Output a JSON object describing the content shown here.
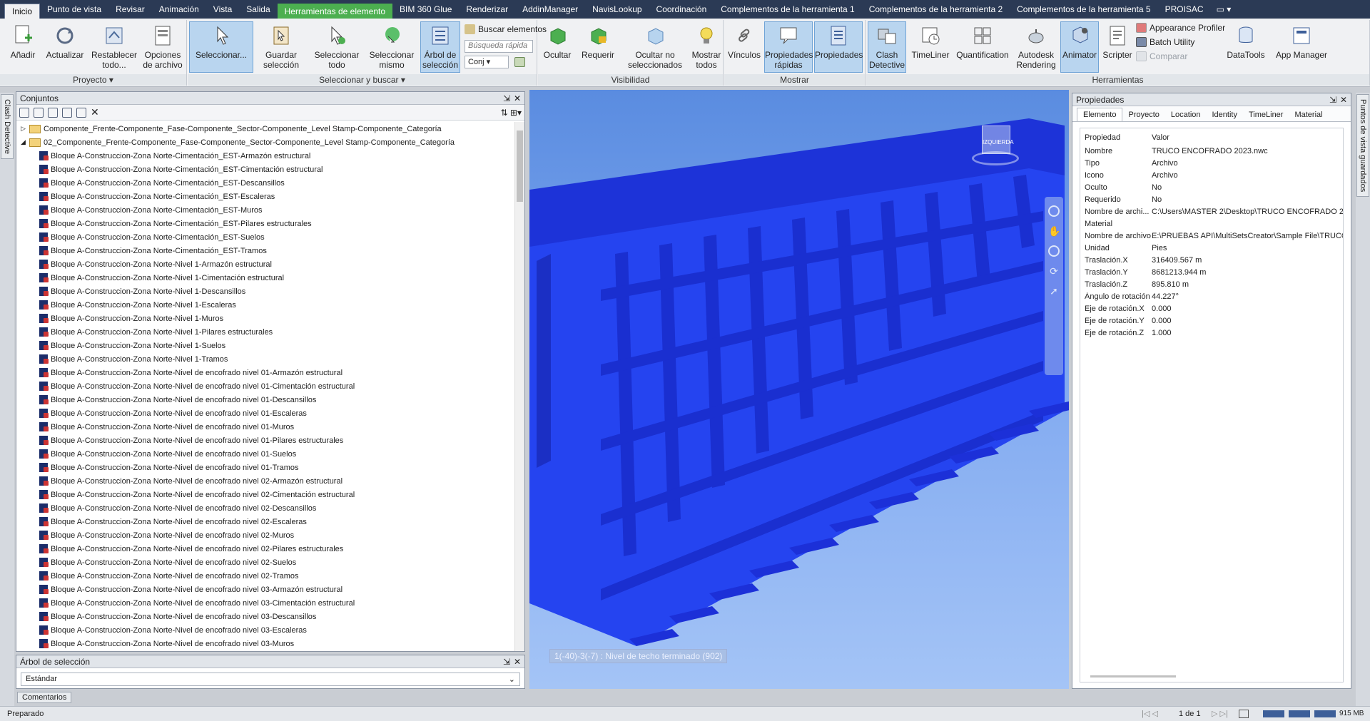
{
  "tabs": [
    "Inicio",
    "Punto de vista",
    "Revisar",
    "Animación",
    "Vista",
    "Salida",
    "Herramientas de elemento",
    "BIM 360 Glue",
    "Renderizar",
    "AddinManager",
    "NavisLookup",
    "Coordinación",
    "Complementos de la herramienta 1",
    "Complementos de la herramienta 2",
    "Complementos de la herramienta 5",
    "PROISAC"
  ],
  "active_tab_index": 6,
  "ribbon": {
    "proyecto": {
      "title": "Proyecto",
      "anadir": "Añadir",
      "actualizar": "Actualizar",
      "restablecer": "Restablecer todo...",
      "opciones": "Opciones de archivo"
    },
    "seleccionar": {
      "title": "Seleccionar y buscar",
      "seleccionar": "Seleccionar...",
      "guardar": "Guardar selección",
      "sel_todo": "Seleccionar todo",
      "sel_mismo": "Seleccionar mismo",
      "arbol": "Árbol de selección",
      "buscar": "Buscar elementos",
      "busqueda_placeholder": "Búsqueda rápida",
      "conj": "Conj"
    },
    "visibilidad": {
      "title": "Visibilidad",
      "ocultar": "Ocultar",
      "requerir": "Requerir",
      "ocultar_no": "Ocultar no seleccionados",
      "mostrar": "Mostrar todos"
    },
    "mostrar": {
      "title": "Mostrar",
      "vinculos": "Vínculos",
      "prop_rapidas": "Propiedades rápidas",
      "propiedades": "Propiedades"
    },
    "herramientas": {
      "title": "Herramientas",
      "clash": "Clash Detective",
      "timeliner": "TimeLiner",
      "quantification": "Quantification",
      "autodesk": "Autodesk Rendering",
      "animator": "Animator",
      "scripter": "Scripter",
      "appearance": "Appearance Profiler",
      "batch": "Batch Utility",
      "comparar": "Comparar",
      "datatools": "DataTools",
      "appmanager": "App Manager"
    }
  },
  "left_vtab": "Clash Detective",
  "right_vtab": "Puntos de vista guardados",
  "conjuntos": {
    "title": "Conjuntos",
    "root1": "Componente_Frente-Componente_Fase-Componente_Sector-Componente_Level Stamp-Componente_Categoría",
    "root2": "02_Componente_Frente-Componente_Fase-Componente_Sector-Componente_Level Stamp-Componente_Categoría",
    "items": [
      "Bloque A-Construccion-Zona Norte-Cimentación_EST-Armazón estructural",
      "Bloque A-Construccion-Zona Norte-Cimentación_EST-Cimentación estructural",
      "Bloque A-Construccion-Zona Norte-Cimentación_EST-Descansillos",
      "Bloque A-Construccion-Zona Norte-Cimentación_EST-Escaleras",
      "Bloque A-Construccion-Zona Norte-Cimentación_EST-Muros",
      "Bloque A-Construccion-Zona Norte-Cimentación_EST-Pilares estructurales",
      "Bloque A-Construccion-Zona Norte-Cimentación_EST-Suelos",
      "Bloque A-Construccion-Zona Norte-Cimentación_EST-Tramos",
      "Bloque A-Construccion-Zona Norte-Nivel 1-Armazón estructural",
      "Bloque A-Construccion-Zona Norte-Nivel 1-Cimentación estructural",
      "Bloque A-Construccion-Zona Norte-Nivel 1-Descansillos",
      "Bloque A-Construccion-Zona Norte-Nivel 1-Escaleras",
      "Bloque A-Construccion-Zona Norte-Nivel 1-Muros",
      "Bloque A-Construccion-Zona Norte-Nivel 1-Pilares estructurales",
      "Bloque A-Construccion-Zona Norte-Nivel 1-Suelos",
      "Bloque A-Construccion-Zona Norte-Nivel 1-Tramos",
      "Bloque A-Construccion-Zona Norte-Nivel de encofrado nivel 01-Armazón estructural",
      "Bloque A-Construccion-Zona Norte-Nivel de encofrado nivel 01-Cimentación estructural",
      "Bloque A-Construccion-Zona Norte-Nivel de encofrado nivel 01-Descansillos",
      "Bloque A-Construccion-Zona Norte-Nivel de encofrado nivel 01-Escaleras",
      "Bloque A-Construccion-Zona Norte-Nivel de encofrado nivel 01-Muros",
      "Bloque A-Construccion-Zona Norte-Nivel de encofrado nivel 01-Pilares estructurales",
      "Bloque A-Construccion-Zona Norte-Nivel de encofrado nivel 01-Suelos",
      "Bloque A-Construccion-Zona Norte-Nivel de encofrado nivel 01-Tramos",
      "Bloque A-Construccion-Zona Norte-Nivel de encofrado nivel 02-Armazón estructural",
      "Bloque A-Construccion-Zona Norte-Nivel de encofrado nivel 02-Cimentación estructural",
      "Bloque A-Construccion-Zona Norte-Nivel de encofrado nivel 02-Descansillos",
      "Bloque A-Construccion-Zona Norte-Nivel de encofrado nivel 02-Escaleras",
      "Bloque A-Construccion-Zona Norte-Nivel de encofrado nivel 02-Muros",
      "Bloque A-Construccion-Zona Norte-Nivel de encofrado nivel 02-Pilares estructurales",
      "Bloque A-Construccion-Zona Norte-Nivel de encofrado nivel 02-Suelos",
      "Bloque A-Construccion-Zona Norte-Nivel de encofrado nivel 02-Tramos",
      "Bloque A-Construccion-Zona Norte-Nivel de encofrado nivel 03-Armazón estructural",
      "Bloque A-Construccion-Zona Norte-Nivel de encofrado nivel 03-Cimentación estructural",
      "Bloque A-Construccion-Zona Norte-Nivel de encofrado nivel 03-Descansillos",
      "Bloque A-Construccion-Zona Norte-Nivel de encofrado nivel 03-Escaleras",
      "Bloque A-Construccion-Zona Norte-Nivel de encofrado nivel 03-Muros"
    ]
  },
  "arbol": {
    "title": "Árbol de selección",
    "value": "Estándar"
  },
  "comentarios": "Comentarios",
  "viewport": {
    "tag": "1(-40)-3(-7) : Nivel de techo terminado (902)",
    "viewcube": "IZQUIERDA"
  },
  "propiedades": {
    "title": "Propiedades",
    "tabs": [
      "Elemento",
      "Proyecto",
      "Location",
      "Identity",
      "TimeLiner",
      "Material"
    ],
    "header": {
      "k": "Propiedad",
      "v": "Valor"
    },
    "rows": [
      {
        "k": "Nombre",
        "v": "TRUCO ENCOFRADO 2023.nwc"
      },
      {
        "k": "Tipo",
        "v": "Archivo"
      },
      {
        "k": "Icono",
        "v": "Archivo"
      },
      {
        "k": "Oculto",
        "v": "No"
      },
      {
        "k": "Requerido",
        "v": "No"
      },
      {
        "k": "Nombre de archi...",
        "v": "C:\\Users\\MASTER 2\\Desktop\\TRUCO ENCOFRADO 2"
      },
      {
        "k": "Material",
        "v": ""
      },
      {
        "k": "Nombre de archivo",
        "v": "E:\\PRUEBAS API\\MultiSetsCreator\\Sample File\\TRUCO"
      },
      {
        "k": "Unidad",
        "v": "Pies"
      },
      {
        "k": "Traslación.X",
        "v": "316409.567 m"
      },
      {
        "k": "Traslación.Y",
        "v": "8681213.944 m"
      },
      {
        "k": "Traslación.Z",
        "v": "895.810 m"
      },
      {
        "k": "Ángulo de rotación",
        "v": "44.227°"
      },
      {
        "k": "Eje de rotación.X",
        "v": "0.000"
      },
      {
        "k": "Eje de rotación.Y",
        "v": "0.000"
      },
      {
        "k": "Eje de rotación.Z",
        "v": "1.000"
      }
    ]
  },
  "status": {
    "text": "Preparado",
    "page": "1 de 1",
    "memory": "915 MB"
  },
  "colors": {
    "tabbar": "#2b3a55",
    "active_tab": "#4caf50",
    "model": "#1f3cf0"
  }
}
